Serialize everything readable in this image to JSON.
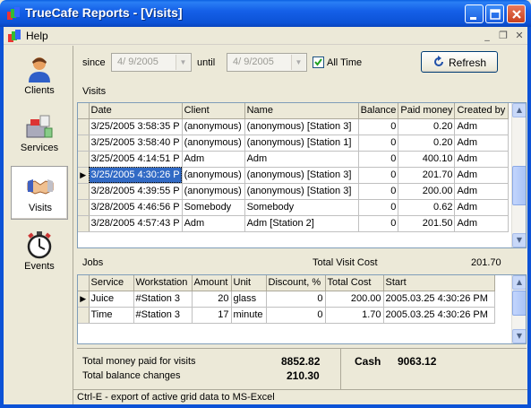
{
  "window": {
    "title": "TrueCafe Reports - [Visits]"
  },
  "menu": {
    "help": "Help"
  },
  "sidebar": {
    "items": [
      {
        "label": "Clients",
        "icon": "person-icon"
      },
      {
        "label": "Services",
        "icon": "services-icon"
      },
      {
        "label": "Visits",
        "icon": "handshake-icon"
      },
      {
        "label": "Events",
        "icon": "stopwatch-icon"
      }
    ],
    "active": "Visits"
  },
  "filters": {
    "since_label": "since",
    "since_value": "4/ 9/2005",
    "until_label": "until",
    "until_value": "4/ 9/2005",
    "all_time_label": "All Time",
    "all_time_checked": true,
    "refresh_label": "Refresh"
  },
  "visits": {
    "title": "Visits",
    "columns": [
      "Date",
      "Client",
      "Name",
      "Balance",
      "Paid money",
      "Created by"
    ],
    "rows": [
      [
        "3/25/2005 3:58:35 P",
        "(anonymous)",
        "(anonymous) [Station 3]",
        "0",
        "0.20",
        "Adm"
      ],
      [
        "3/25/2005 3:58:40 P",
        "(anonymous)",
        "(anonymous) [Station 1]",
        "0",
        "0.20",
        "Adm"
      ],
      [
        "3/25/2005 4:14:51 P",
        "Adm",
        "Adm",
        "0",
        "400.10",
        "Adm"
      ],
      [
        "3/25/2005 4:30:26 P",
        "(anonymous)",
        "(anonymous) [Station 3]",
        "0",
        "201.70",
        "Adm"
      ],
      [
        "3/28/2005 4:39:55 P",
        "(anonymous)",
        "(anonymous) [Station 3]",
        "0",
        "200.00",
        "Adm"
      ],
      [
        "3/28/2005 4:46:56 P",
        "Somebody",
        "Somebody",
        "0",
        "0.62",
        "Adm"
      ],
      [
        "3/28/2005 4:57:43 P",
        "Adm",
        "Adm [Station 2]",
        "0",
        "201.50",
        "Adm"
      ]
    ],
    "selected_row": 3
  },
  "jobs": {
    "title": "Jobs",
    "total_visit_cost_label": "Total Visit Cost",
    "total_visit_cost": "201.70",
    "columns": [
      "Service",
      "Workstation",
      "Amount",
      "Unit",
      "Discount, %",
      "Total Cost",
      "Start"
    ],
    "rows": [
      [
        "Juice",
        "#Station 3",
        "20",
        "glass",
        "0",
        "200.00",
        "2005.03.25 4:30:26 PM"
      ],
      [
        "Time",
        "#Station 3",
        "17",
        "minute",
        "0",
        "1.70",
        "2005.03.25 4:30:26 PM"
      ]
    ],
    "current_row": 0
  },
  "totals": {
    "money_paid_label": "Total money paid for visits",
    "money_paid": "8852.82",
    "balance_changes_label": "Total balance changes",
    "balance_changes": "210.30",
    "cash_label": "Cash",
    "cash": "9063.12"
  },
  "status": {
    "text": "Ctrl-E - export of active grid data to MS-Excel"
  },
  "colors": {
    "titlebar": "#0c52d6",
    "selection": "#316ac5",
    "face": "#ece9d8"
  }
}
